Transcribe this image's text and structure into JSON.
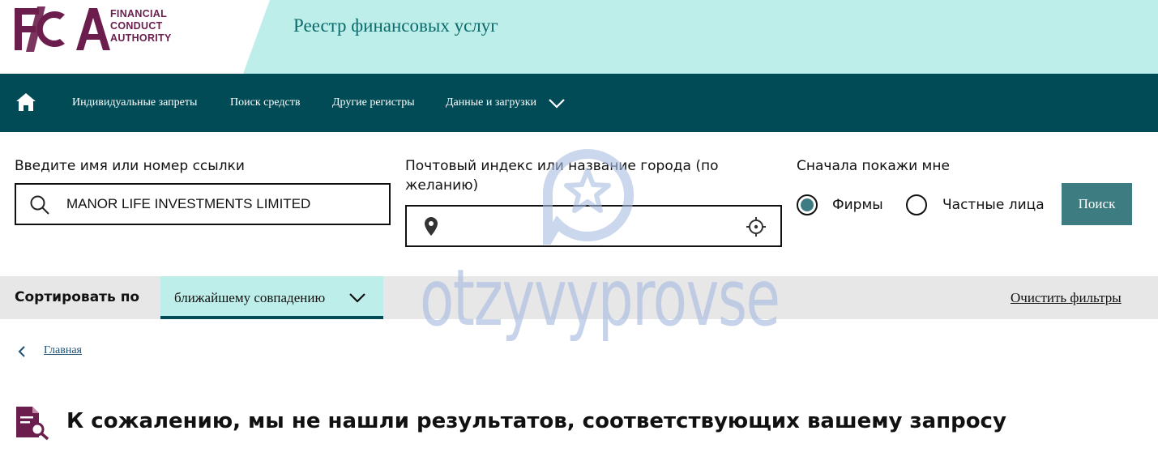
{
  "header": {
    "logo_lines": [
      "FINANCIAL",
      "CONDUCT",
      "AUTHORITY"
    ],
    "register_title": "Реестр финансовых услуг"
  },
  "nav": {
    "items": [
      {
        "label": "Индивидуальные запреты"
      },
      {
        "label": "Поиск средств"
      },
      {
        "label": "Другие регистры"
      },
      {
        "label": "Данные и загрузки"
      }
    ]
  },
  "search": {
    "name_label": "Введите имя или номер ссылки",
    "name_value": "MANOR LIFE INVESTMENTS LIMITED",
    "postcode_label_line1": "Почтовый индекс или название города (по",
    "postcode_label_line2": "желанию)",
    "postcode_value": "",
    "show_first_label": "Сначала покажи мне",
    "option_firms": "Фирмы",
    "option_individuals": "Частные лица",
    "selected_option": "Фирмы",
    "search_button": "Поиск"
  },
  "sort": {
    "label": "Сортировать по",
    "selected": "ближайшему совпадению",
    "clear_filters": "Очистить фильтры"
  },
  "breadcrumb": {
    "home": "Главная"
  },
  "results": {
    "no_results_title": "К сожалению, мы не нашли результатов, соответствующих вашему запросу"
  },
  "watermark": {
    "text": "otzyvyprovse"
  },
  "colors": {
    "brand_plum": "#6b1e4d",
    "header_mint": "#bdeeea",
    "nav_teal": "#004b55",
    "button_teal": "#3d7d82",
    "sort_bar_gray": "#e7e7e7"
  }
}
